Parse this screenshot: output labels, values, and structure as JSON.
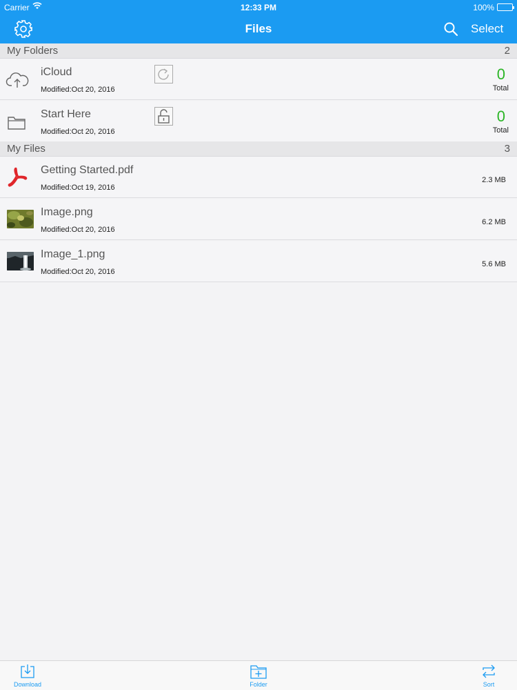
{
  "status_bar": {
    "carrier": "Carrier",
    "time": "12:33 PM",
    "battery": "100%"
  },
  "nav": {
    "title": "Files",
    "select_label": "Select"
  },
  "folders": {
    "header": "My Folders",
    "count": "2",
    "items": [
      {
        "name": "iCloud",
        "modified": "Modified:Oct 20, 2016",
        "total_value": "0",
        "total_label": "Total",
        "icon": "cloud-upload-icon",
        "badge_icon": "sync-icon"
      },
      {
        "name": "Start Here",
        "modified": "Modified:Oct 20, 2016",
        "total_value": "0",
        "total_label": "Total",
        "icon": "folder-icon",
        "badge_icon": "unlock-icon"
      }
    ]
  },
  "files": {
    "header": "My Files",
    "count": "3",
    "items": [
      {
        "name": "Getting Started.pdf",
        "modified": "Modified:Oct 19, 2016",
        "size": "2.3 MB",
        "icon": "pdf-icon"
      },
      {
        "name": "Image.png",
        "modified": "Modified:Oct 20, 2016",
        "size": "6.2 MB",
        "icon": "image-thumbnail"
      },
      {
        "name": "Image_1.png",
        "modified": "Modified:Oct 20, 2016",
        "size": "5.6 MB",
        "icon": "image-thumbnail"
      }
    ]
  },
  "tabbar": {
    "download_label": "Download",
    "folder_label": "Folder",
    "sort_label": "Sort"
  },
  "colors": {
    "accent": "#1b9bf2",
    "count_green": "#2bb526",
    "pdf_red": "#e0262b"
  }
}
